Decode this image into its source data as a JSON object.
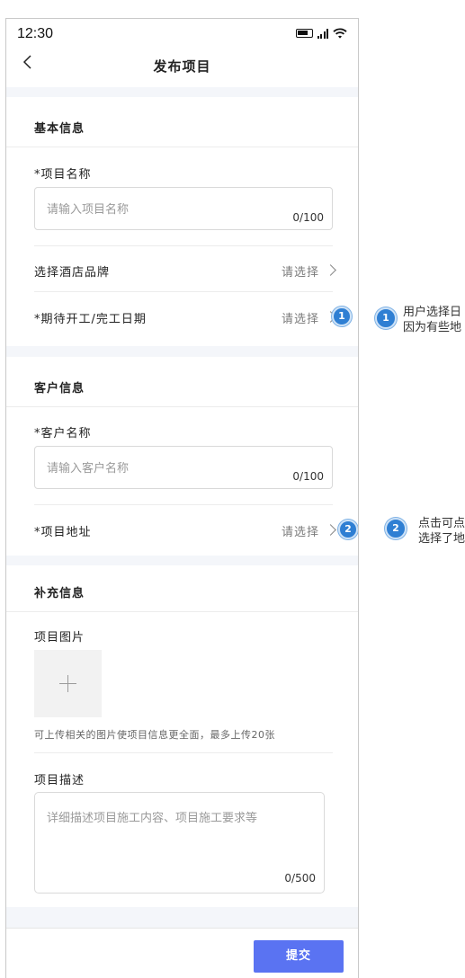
{
  "status_bar": {
    "time": "12:30"
  },
  "header": {
    "title": "发布项目"
  },
  "basic_info": {
    "section_title": "基本信息",
    "project_name": {
      "label": "*项目名称",
      "placeholder": "请输入项目名称",
      "counter": "0/100"
    },
    "hotel_brand": {
      "label": "选择酒店品牌",
      "value": "请选择"
    },
    "expected_dates": {
      "label": "*期待开工/完工日期",
      "value": "请选择"
    }
  },
  "customer_info": {
    "section_title": "客户信息",
    "customer_name": {
      "label": "*客户名称",
      "placeholder": "请输入客户名称",
      "counter": "0/100"
    },
    "project_address": {
      "label": "*项目地址",
      "value": "请选择"
    }
  },
  "supplementary_info": {
    "section_title": "补充信息",
    "images": {
      "label": "项目图片",
      "hint": "可上传相关的图片使项目信息更全面，最多上传20张"
    },
    "description": {
      "label": "项目描述",
      "placeholder": "详细描述项目施工内容、项目施工要求等",
      "counter": "0/500"
    }
  },
  "footer": {
    "submit_label": "提交"
  },
  "annotations": [
    {
      "number": "1",
      "line1": "用户选择日",
      "line2": "因为有些地"
    },
    {
      "number": "2",
      "line1": "点击可点",
      "line2": "选择了地"
    }
  ],
  "colors": {
    "primary": "#5a73f2",
    "annotation_badge": "#2f7fd3",
    "section_gap": "#f4f6fa"
  }
}
